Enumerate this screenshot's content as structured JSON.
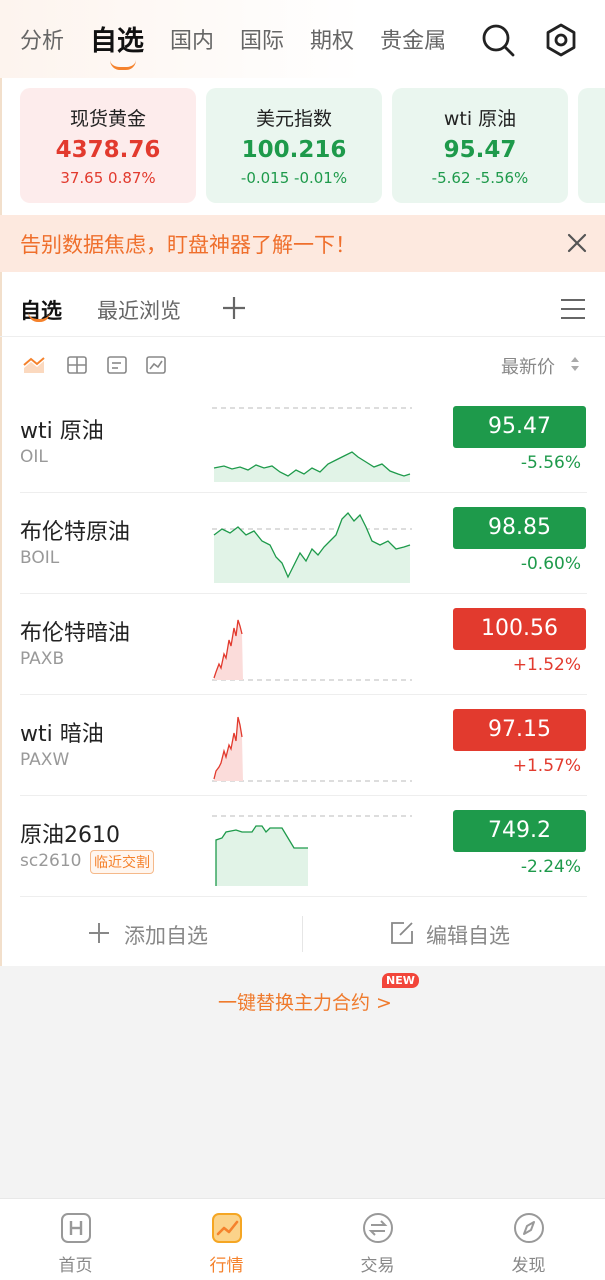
{
  "top_nav": {
    "tabs": [
      "分析",
      "自选",
      "国内",
      "国际",
      "期权",
      "贵金属"
    ],
    "active_index": 1,
    "search_icon": "search-icon",
    "settings_icon": "settings-icon"
  },
  "cards": [
    {
      "name": "现货黄金",
      "price": "4378.76",
      "change": "37.65  0.87%",
      "trend": "up"
    },
    {
      "name": "美元指数",
      "price": "100.216",
      "change": "-0.015  -0.01%",
      "trend": "down"
    },
    {
      "name": "wti 原油",
      "price": "95.47",
      "change": "-5.62  -5.56%",
      "trend": "down"
    },
    {
      "name": "",
      "price": "",
      "change": "",
      "trend": "down"
    }
  ],
  "banner": {
    "text": "告别数据焦虑，盯盘神器了解一下！",
    "close_icon": "close-icon"
  },
  "sub_tabs": {
    "tabs": [
      "自选",
      "最近浏览"
    ],
    "active_index": 0,
    "add_icon": "plus-icon",
    "menu_icon": "menu-icon"
  },
  "view_modes": {
    "icons": [
      "trend-view-icon",
      "grid-view-icon",
      "card-view-icon",
      "chart-view-icon"
    ],
    "active_index": 0,
    "sort_label": "最新价",
    "sort_icon": "sort-icon"
  },
  "watchlist": [
    {
      "name": "wti 原油",
      "code": "OIL",
      "tag": "",
      "price": "95.47",
      "pct": "-5.56%",
      "trend": "down"
    },
    {
      "name": "布伦特原油",
      "code": "BOIL",
      "tag": "",
      "price": "98.85",
      "pct": "-0.60%",
      "trend": "down"
    },
    {
      "name": "布伦特暗油",
      "code": "PAXB",
      "tag": "",
      "price": "100.56",
      "pct": "+1.52%",
      "trend": "up"
    },
    {
      "name": "wti 暗油",
      "code": "PAXW",
      "tag": "",
      "price": "97.15",
      "pct": "+1.57%",
      "trend": "up"
    },
    {
      "name": "原油2610",
      "code": "sc2610",
      "tag": "临近交割",
      "price": "749.2",
      "pct": "-2.24%",
      "trend": "down"
    }
  ],
  "actions": {
    "add_label": "添加自选",
    "edit_label": "编辑自选"
  },
  "promo": {
    "text": "一键替换主力合约 >",
    "badge": "NEW"
  },
  "bottom_nav": {
    "items": [
      {
        "label": "首页",
        "icon": "home-h-icon"
      },
      {
        "label": "行情",
        "icon": "market-chart-icon"
      },
      {
        "label": "交易",
        "icon": "trade-exchange-icon"
      },
      {
        "label": "发现",
        "icon": "discover-compass-icon"
      }
    ],
    "active_index": 1
  },
  "colors": {
    "accent": "#f5822c",
    "up": "#e23a2e",
    "down": "#1e9a4b"
  }
}
